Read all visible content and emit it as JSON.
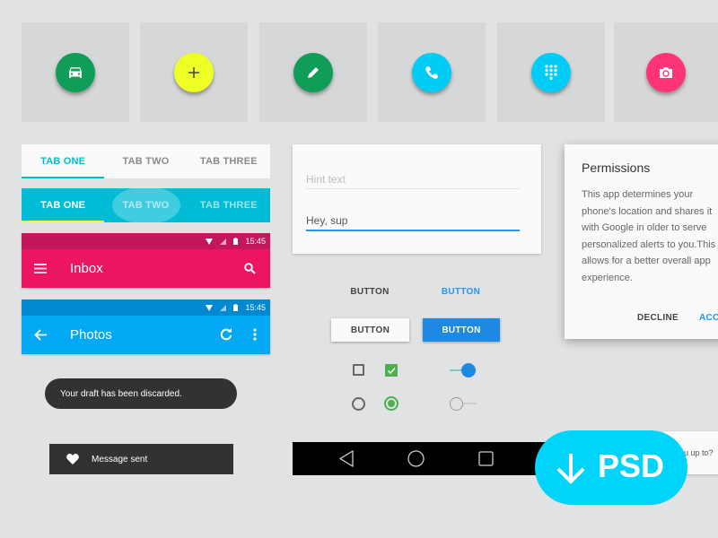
{
  "fabs": [
    {
      "icon": "car-icon",
      "color": "#0f9d58"
    },
    {
      "icon": "plus-icon",
      "color": "#eeff26"
    },
    {
      "icon": "pencil-icon",
      "color": "#0f9d58"
    },
    {
      "icon": "phone-icon",
      "color": "#00ccf5"
    },
    {
      "icon": "dialpad-icon",
      "color": "#00ccf5"
    },
    {
      "icon": "camera-icon",
      "color": "#ff3377"
    }
  ],
  "tabs_light": {
    "items": [
      "TAB ONE",
      "TAB TWO",
      "TAB THREE"
    ],
    "active": 0
  },
  "tabs_color": {
    "items": [
      "TAB ONE",
      "TAB TWO",
      "TAB THREE"
    ],
    "active": 0
  },
  "appbar_inbox": {
    "time": "15:45",
    "title": "Inbox"
  },
  "appbar_photos": {
    "time": "15:45",
    "title": "Photos"
  },
  "snackbar": {
    "text": "Your draft has been discarded."
  },
  "toast": {
    "text": "Message sent"
  },
  "textfields": {
    "hint": "Hint text",
    "value": "Hey, sup"
  },
  "buttons": {
    "flat": "BUTTON",
    "flat_accent": "BUTTON",
    "raised": "BUTTON",
    "raised_accent": "BUTTON"
  },
  "controls": {
    "checkbox_unchecked": false,
    "checkbox_checked": true,
    "radio_unselected": false,
    "radio_selected": true,
    "switch_on": true,
    "switch_off": false
  },
  "dialog": {
    "title": "Permissions",
    "body": "This app determines your phone's location and shares it with Google in older to serve personalized alerts to you.This allows for a better overall app experience.",
    "decline": "DECLINE",
    "accept": "ACCEPT"
  },
  "partial_card": {
    "text": "u up to?"
  },
  "psd_badge": {
    "label": "PSD"
  },
  "colors": {
    "accent": "#1e88e5",
    "cyan": "#00bcd4",
    "pink": "#ec1561",
    "blue": "#03a9f4"
  }
}
